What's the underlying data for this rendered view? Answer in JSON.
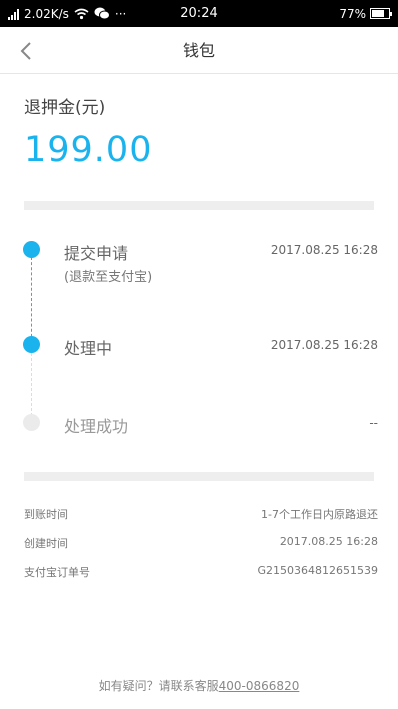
{
  "status_bar": {
    "network_speed": "2.02K/s",
    "time": "20:24",
    "battery": "77%",
    "battery_level": 0.77,
    "icons": [
      "signal-icon",
      "wifi-icon",
      "wechat-icon",
      "more-icon",
      "battery-icon"
    ],
    "more_dots": "···"
  },
  "nav": {
    "back_icon": "chevron-left-icon",
    "title": "钱包"
  },
  "refund": {
    "label": "退押金(元)",
    "amount": "199.00"
  },
  "timeline": [
    {
      "title": "提交申请",
      "subtitle": "(退款至支付宝)",
      "time": "2017.08.25 16:28",
      "state": "active"
    },
    {
      "title": "处理中",
      "subtitle": "",
      "time": "2017.08.25 16:28",
      "state": "active"
    },
    {
      "title": "处理成功",
      "subtitle": "",
      "time": "--",
      "state": "pending"
    }
  ],
  "details": [
    {
      "key": "到账时间",
      "value": "1-7个工作日内原路退还"
    },
    {
      "key": "创建时间",
      "value": "2017.08.25 16:28"
    },
    {
      "key": "支付宝订单号",
      "value": "G2150364812651539"
    }
  ],
  "footer": {
    "text": "如有疑问？请联系客服",
    "phone": "400-0866820"
  },
  "colors": {
    "accent": "#1ab3ee",
    "divider": "#eeeeee",
    "pending": "#ebebeb"
  }
}
